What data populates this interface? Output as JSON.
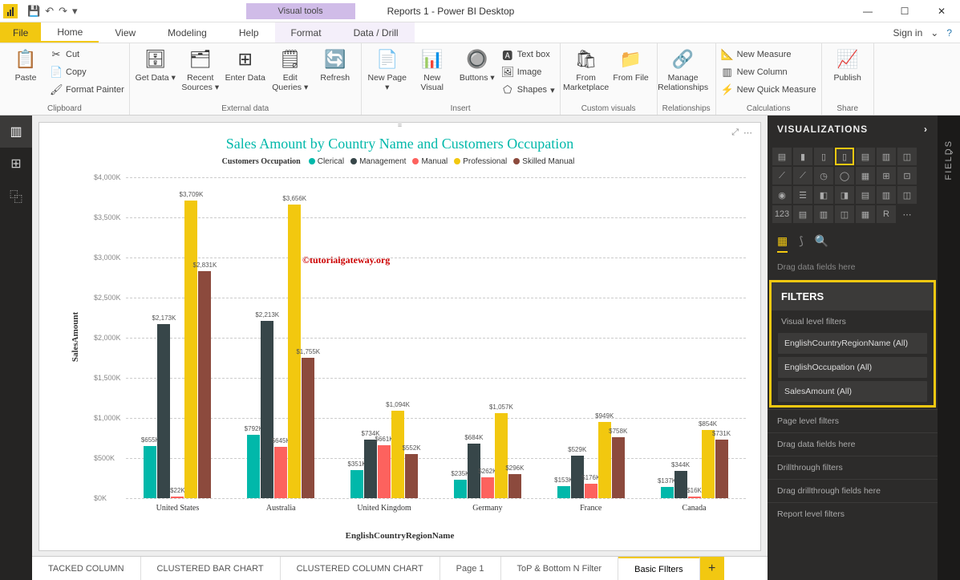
{
  "titlebar": {
    "contextual_label": "Visual tools",
    "title": "Reports 1 - Power BI Desktop"
  },
  "menu": {
    "file": "File",
    "tabs": [
      "Home",
      "View",
      "Modeling",
      "Help",
      "Format",
      "Data / Drill"
    ],
    "signin": "Sign in"
  },
  "ribbon": {
    "clipboard": {
      "paste": "Paste",
      "cut": "Cut",
      "copy": "Copy",
      "fmt": "Format Painter",
      "label": "Clipboard"
    },
    "external": {
      "getdata": "Get\nData",
      "recent": "Recent\nSources",
      "enter": "Enter\nData",
      "edit": "Edit\nQueries",
      "refresh": "Refresh",
      "label": "External data"
    },
    "insert": {
      "newpage": "New\nPage",
      "newvis": "New\nVisual",
      "buttons": "Buttons",
      "textbox": "Text box",
      "image": "Image",
      "shapes": "Shapes",
      "label": "Insert"
    },
    "custom": {
      "market": "From\nMarketplace",
      "file": "From\nFile",
      "label": "Custom visuals"
    },
    "rel": {
      "manage": "Manage\nRelationships",
      "label": "Relationships"
    },
    "calc": {
      "nm": "New Measure",
      "nc": "New Column",
      "nqm": "New Quick Measure",
      "label": "Calculations"
    },
    "share": {
      "publish": "Publish",
      "label": "Share"
    }
  },
  "chart_data": {
    "type": "bar",
    "title": "Sales Amount by Country Name and Customers Occupation",
    "xlabel": "EnglishCountryRegionName",
    "ylabel": "SalesAmount",
    "legend_title": "Customers Occupation",
    "watermark": "©tutorialgateway.org",
    "ylim": [
      0,
      4000
    ],
    "yticks": [
      "$0K",
      "$500K",
      "$1,000K",
      "$1,500K",
      "$2,000K",
      "$2,500K",
      "$3,000K",
      "$3,500K",
      "$4,000K"
    ],
    "series": [
      {
        "name": "Clerical",
        "color": "#01B8AA"
      },
      {
        "name": "Management",
        "color": "#374649"
      },
      {
        "name": "Manual",
        "color": "#FD625E"
      },
      {
        "name": "Professional",
        "color": "#F2C80F"
      },
      {
        "name": "Skilled Manual",
        "color": "#8C4A3D"
      }
    ],
    "categories": [
      "United States",
      "Australia",
      "United Kingdom",
      "Germany",
      "France",
      "Canada"
    ],
    "values": [
      [
        655,
        2173,
        22,
        3709,
        2831
      ],
      [
        792,
        2213,
        645,
        3656,
        1755
      ],
      [
        351,
        734,
        661,
        1094,
        552
      ],
      [
        235,
        684,
        262,
        1057,
        296
      ],
      [
        153,
        529,
        176,
        949,
        758
      ],
      [
        137,
        344,
        16,
        854,
        731
      ]
    ],
    "value_labels": [
      [
        "$655K",
        "$2,173K",
        "$22K",
        "$3,709K",
        "$2,831K"
      ],
      [
        "$792K",
        "$2,213K",
        "$645K",
        "$3,656K",
        "$1,755K"
      ],
      [
        "$351K",
        "$734K",
        "$661K",
        "$1,094K",
        "$552K"
      ],
      [
        "$235K",
        "$684K",
        "$262K",
        "$1,057K",
        "$296K"
      ],
      [
        "$153K",
        "$529K",
        "$176K",
        "$949K",
        "$758K"
      ],
      [
        "$137K",
        "$344K",
        "$16K",
        "$854K",
        "$731K"
      ]
    ]
  },
  "page_tabs": [
    "TACKED COLUMN",
    "CLUSTERED BAR CHART",
    "CLUSTERED COLUMN CHART",
    "Page 1",
    "ToP & Bottom N Filter",
    "Basic FIlters"
  ],
  "viz": {
    "header": "VISUALIZATIONS",
    "drag": "Drag data fields here",
    "filters_header": "FILTERS",
    "visual_level": "Visual level filters",
    "items": [
      "EnglishCountryRegionName  (All)",
      "EnglishOccupation  (All)",
      "SalesAmount  (All)"
    ],
    "page_level": "Page level filters",
    "drag2": "Drag data fields here",
    "drill": "Drillthrough filters",
    "drag3": "Drag drillthrough fields here",
    "report_level": "Report level filters"
  },
  "fields_label": "FIELDS"
}
